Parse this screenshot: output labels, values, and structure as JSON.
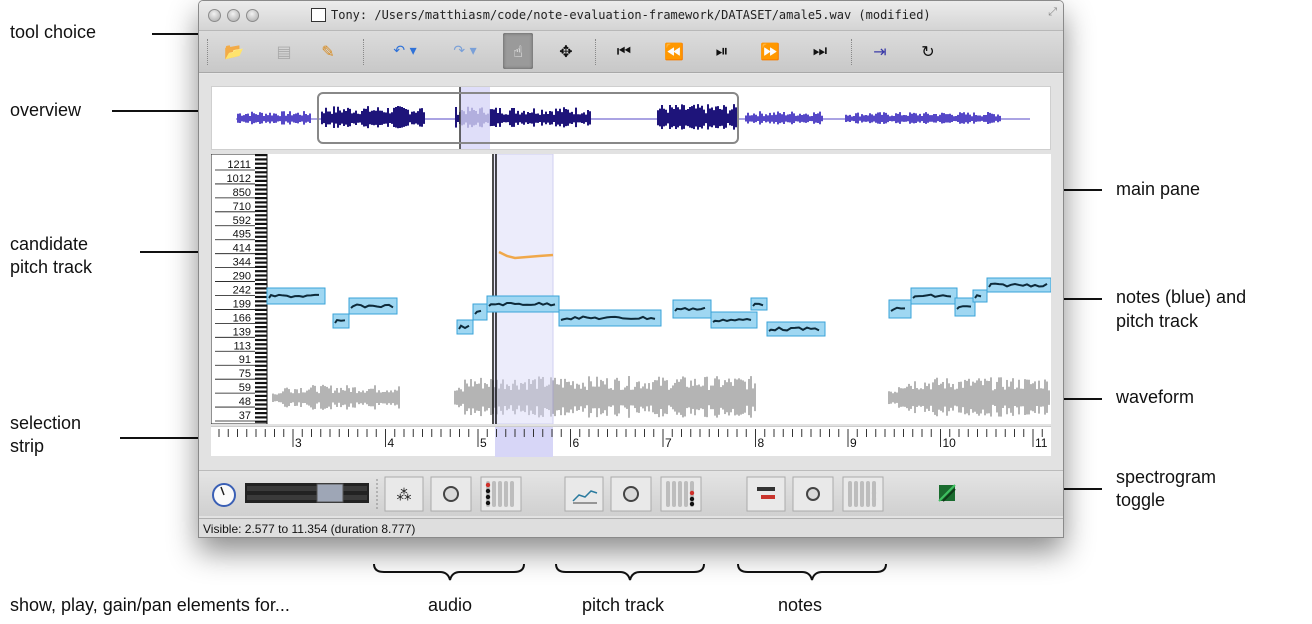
{
  "annotations": {
    "tool_choice": "tool choice",
    "overview": "overview",
    "candidate_pitch_track_line1": "candidate",
    "candidate_pitch_track_line2": "pitch track",
    "selection_strip_line1": "selection",
    "selection_strip_line2": "strip",
    "main_pane": "main pane",
    "notes_line1": "notes (blue) and",
    "notes_line2": "pitch track",
    "waveform": "waveform",
    "spectrogram_toggle_line1": "spectrogram",
    "spectrogram_toggle_line2": "toggle",
    "show_play_gain": "show, play, gain/pan elements for...",
    "group_audio": "audio",
    "group_pitch_track": "pitch track",
    "group_notes": "notes"
  },
  "window": {
    "title": "Tony: /Users/matthiasm/code/note-evaluation-framework/DATASET/amale5.wav (modified)",
    "status": "Visible: 2.577 to 11.354 (duration 8.777)"
  },
  "toolbar": {
    "items": [
      {
        "name": "open-icon",
        "glyph": "📂"
      },
      {
        "name": "save-icon",
        "glyph": "▤"
      },
      {
        "name": "save-as-icon",
        "glyph": "✎"
      },
      {
        "name": "undo-icon",
        "glyph": "↶ ▾"
      },
      {
        "name": "redo-icon",
        "glyph": "↷ ▾"
      },
      {
        "name": "navigate-tool-icon",
        "glyph": "☝"
      },
      {
        "name": "edit-tool-icon",
        "glyph": "✥"
      },
      {
        "name": "rewind-start-icon",
        "glyph": "⏮"
      },
      {
        "name": "rewind-icon",
        "glyph": "⏪"
      },
      {
        "name": "play-pause-icon",
        "glyph": "⏯"
      },
      {
        "name": "fast-forward-icon",
        "glyph": "⏩"
      },
      {
        "name": "fast-forward-end-icon",
        "glyph": "⏭"
      },
      {
        "name": "play-selection-icon",
        "glyph": "⇥"
      },
      {
        "name": "loop-icon",
        "glyph": "↻"
      }
    ]
  },
  "pitch_scale": [
    "1211",
    "1012",
    "850",
    "710",
    "592",
    "495",
    "414",
    "344",
    "290",
    "242",
    "199",
    "166",
    "139",
    "113",
    "91",
    "75",
    "59",
    "48",
    "37"
  ],
  "time_ruler": [
    "3",
    "4",
    "5",
    "6",
    "7",
    "8",
    "9",
    "10",
    "11"
  ],
  "colors": {
    "note_fill": "#9fd7f2",
    "note_stroke": "#3aa3d8",
    "pitch_line": "#0d2a3a",
    "candidate": "#f0a84a",
    "waveform": "#b4b4b4",
    "overview_wave": "#5547c7",
    "overview_wave_dark": "#1e147a",
    "selection": "#d7d6f7"
  }
}
